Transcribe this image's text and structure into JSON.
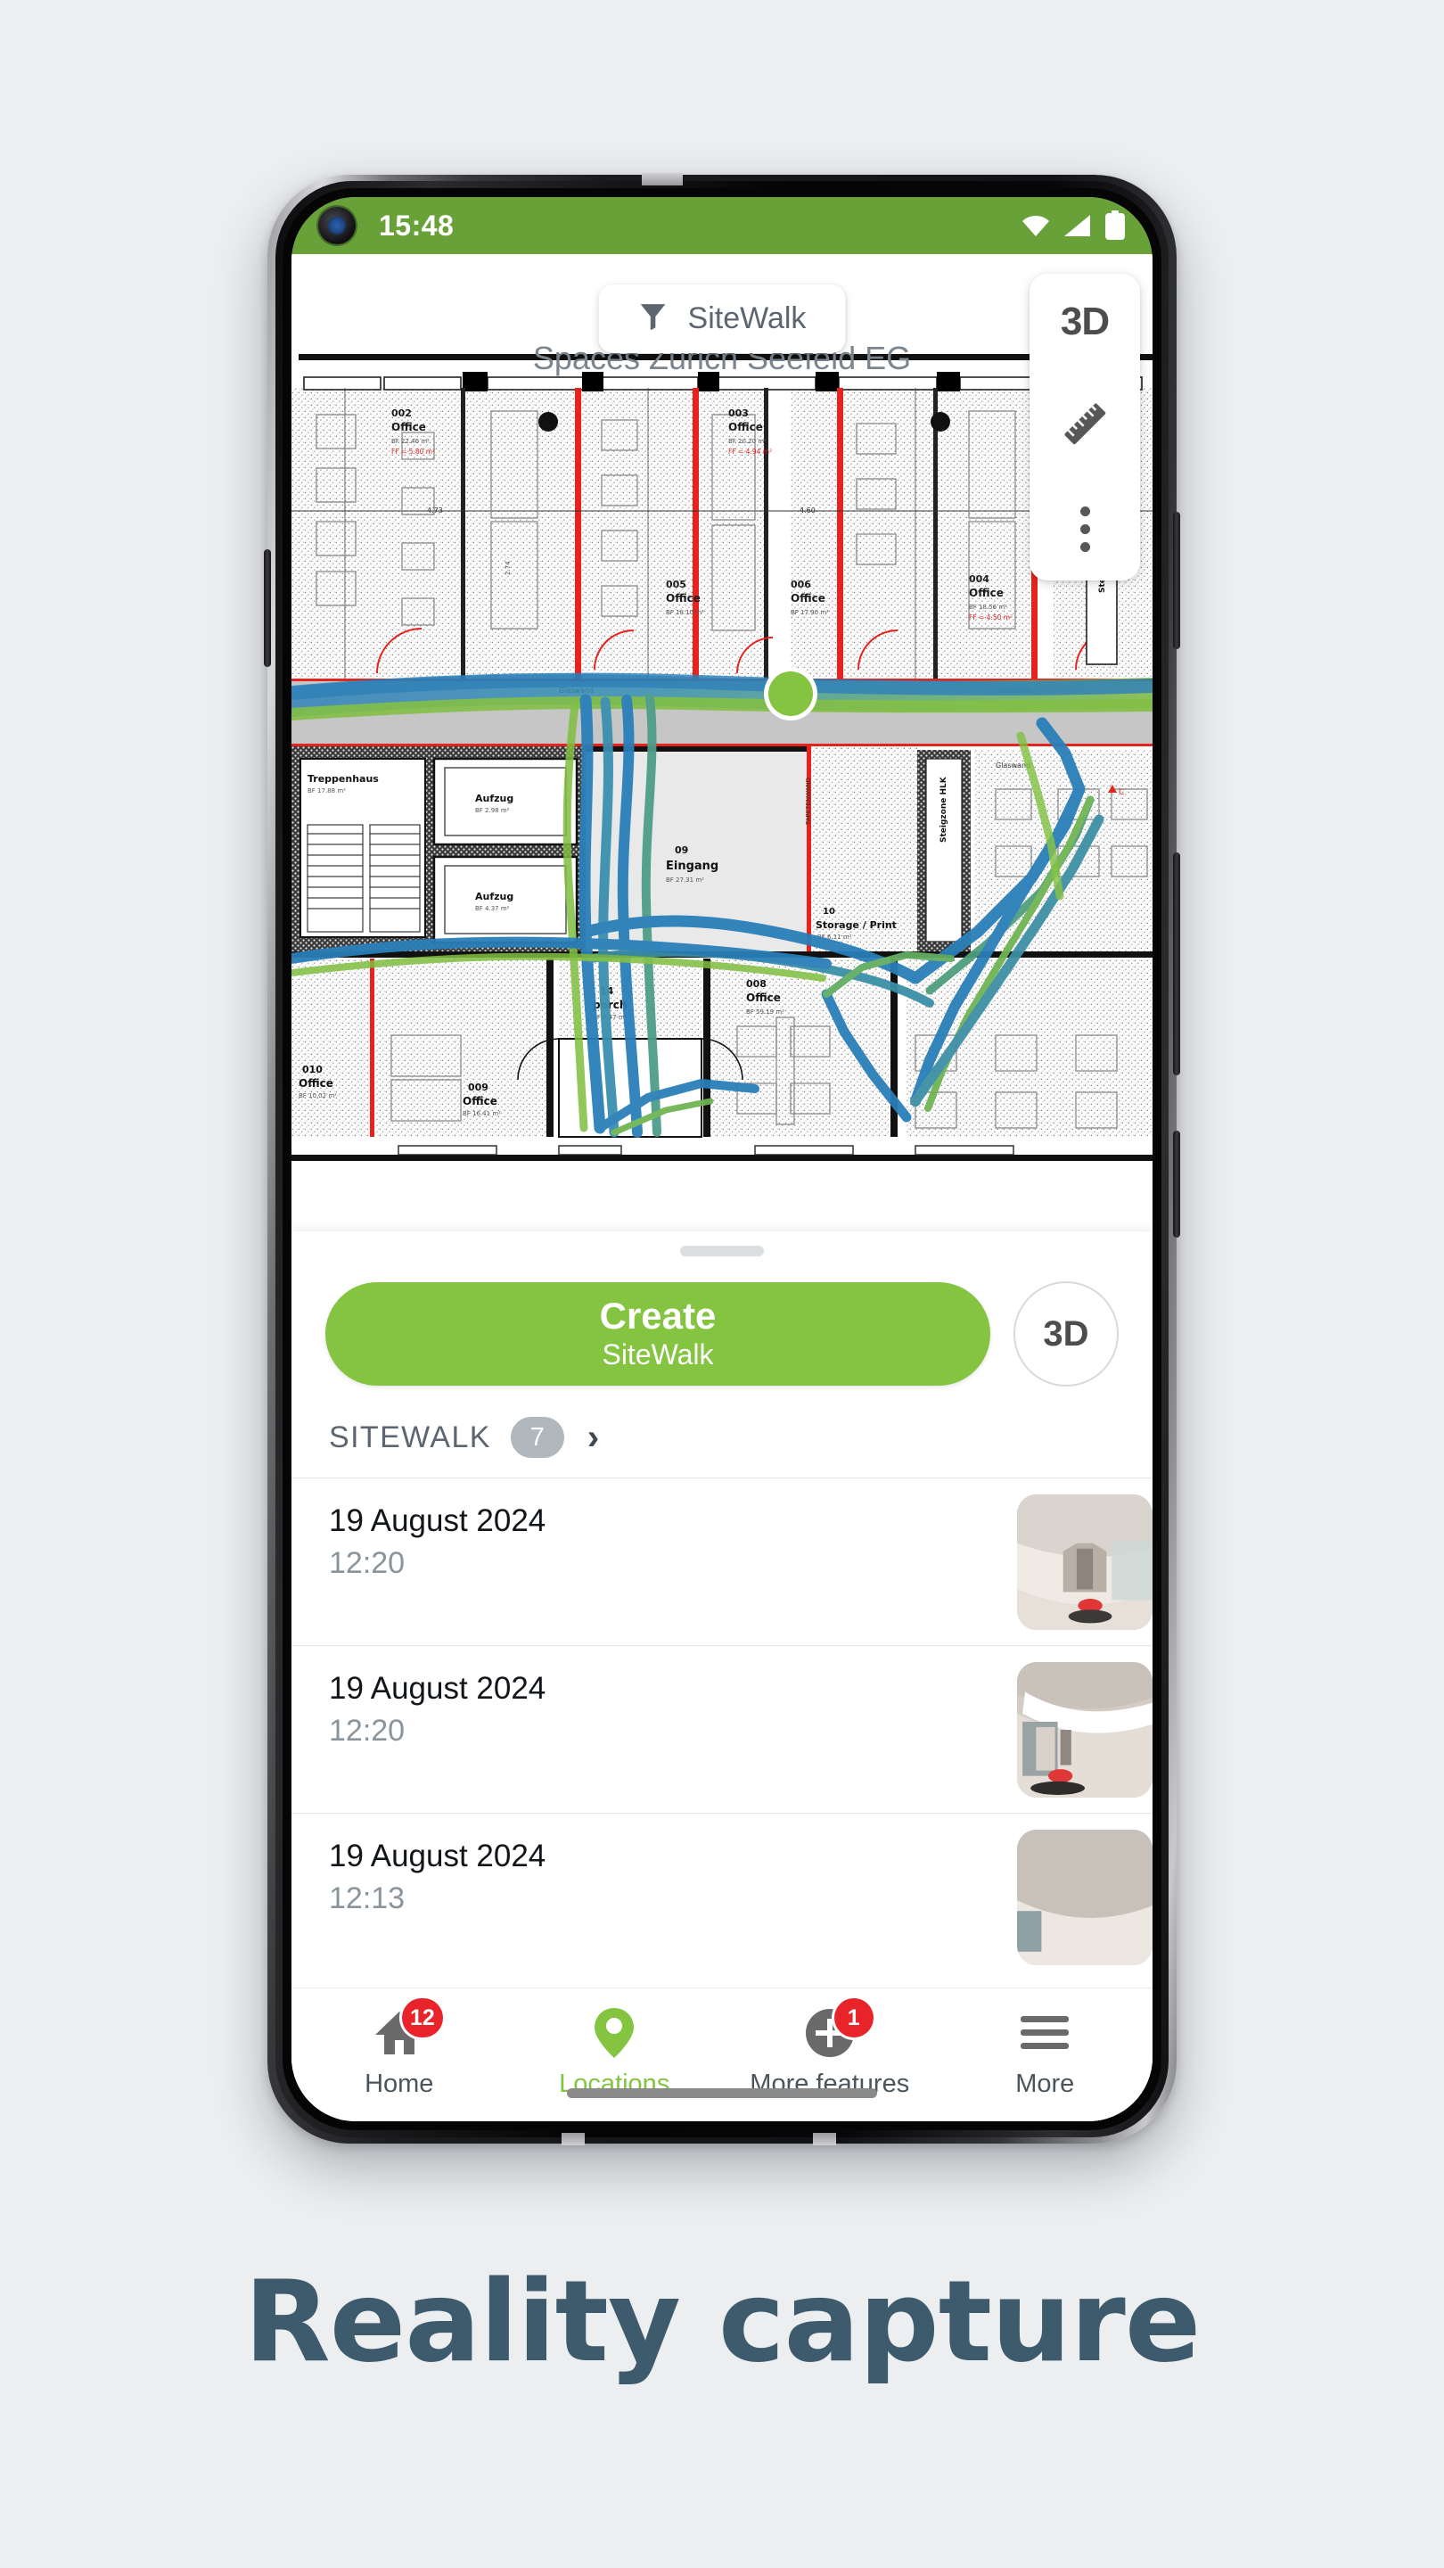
{
  "status_bar": {
    "time": "15:48",
    "icons": [
      "wifi-icon",
      "signal-icon",
      "battery-icon"
    ],
    "background_color": "#67a138"
  },
  "map": {
    "filter_chip": {
      "label": "SiteWalk",
      "icon": "filter-icon"
    },
    "plan_title": "Spaces Zurich Seefeld EG",
    "tools": [
      {
        "name": "3d-toggle",
        "label": "3D"
      },
      {
        "name": "measure-tool",
        "label": "",
        "icon": "ruler-icon"
      },
      {
        "name": "more-options",
        "label": "",
        "icon": "three-dots-icon"
      }
    ],
    "floorplan": {
      "rooms": [
        {
          "id": "002",
          "label": "Office"
        },
        {
          "id": "003",
          "label": "Office"
        },
        {
          "id": "004",
          "label": "Office"
        },
        {
          "id": "005",
          "label": "Office"
        },
        {
          "id": "006",
          "label": "Office"
        },
        {
          "id": "008",
          "label": "Office"
        },
        {
          "id": "009",
          "label": "Office"
        },
        {
          "id": "010",
          "label": "Office"
        },
        {
          "id": "09",
          "label": "Eingang"
        },
        {
          "id": "10",
          "label": "Storage / Print"
        },
        {
          "id": "14",
          "label": "porch"
        },
        {
          "id": "",
          "label": "Treppenhaus"
        },
        {
          "id": "",
          "label": "Aufzug"
        },
        {
          "id": "",
          "label": "Aufzug"
        },
        {
          "id": "",
          "label": "Steigzone HLK"
        },
        {
          "id": "",
          "label": "Glaswand"
        }
      ],
      "path_colors": [
        "#2a7fb8",
        "#7fbf3f"
      ],
      "marker_color": "#85c441"
    }
  },
  "sheet": {
    "create_button": {
      "line1": "Create",
      "line2": "SiteWalk"
    },
    "view_3d_button": "3D",
    "section": {
      "title": "SITEWALK",
      "count": "7",
      "chevron": "chevron-right-icon"
    },
    "items": [
      {
        "date": "19 August 2024",
        "time": "12:20"
      },
      {
        "date": "19 August 2024",
        "time": "12:20"
      },
      {
        "date": "19 August 2024",
        "time": "12:13"
      }
    ]
  },
  "bottom_nav": {
    "items": [
      {
        "label": "Home",
        "icon": "home-icon",
        "badge": "12",
        "active": false
      },
      {
        "label": "Locations",
        "icon": "map-pin-icon",
        "badge": "",
        "active": true
      },
      {
        "label": "More features",
        "icon": "plus-circle-icon",
        "badge": "1",
        "active": false
      },
      {
        "label": "More",
        "icon": "hamburger-icon",
        "badge": "",
        "active": false
      }
    ],
    "active_color": "#85c441",
    "badge_color": "#e8242a"
  },
  "caption": {
    "text": "Reality capture",
    "color": "#3e5b6d"
  }
}
